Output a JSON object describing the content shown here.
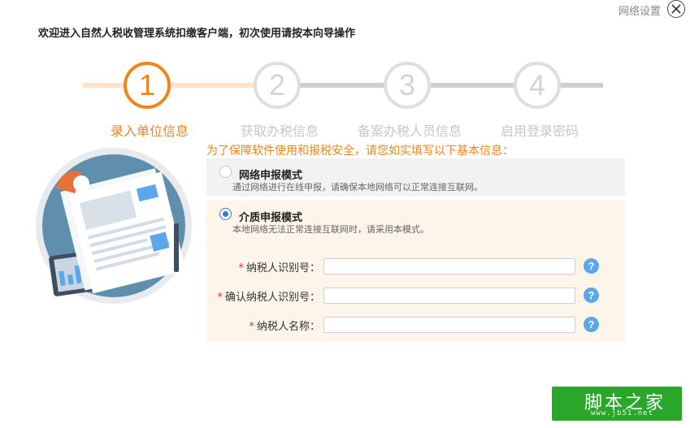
{
  "header": {
    "network_settings_label": "网络设置",
    "welcome_text": "欢迎进入自然人税收管理系统扣缴客户端，初次使用请按本向导操作"
  },
  "steps": [
    {
      "number": "1",
      "label": "录入单位信息",
      "active": true
    },
    {
      "number": "2",
      "label": "获取办税信息",
      "active": false
    },
    {
      "number": "3",
      "label": "备案办税人员信息",
      "active": false
    },
    {
      "number": "4",
      "label": "启用登录密码",
      "active": false
    }
  ],
  "notice": "为了保障软件使用和报税安全，请您如实填写以下基本信息：",
  "modes": {
    "network": {
      "title": "网络申报模式",
      "desc": "通过网络进行在线申报，请确保本地网络可以正常连接互联网。",
      "selected": false
    },
    "media": {
      "title": "介质申报模式",
      "desc": "本地网络无法正常连接互联网时，请采用本模式。",
      "selected": true
    }
  },
  "form": {
    "required_mark": "*",
    "taxpayer_id_label": "纳税人识别号：",
    "confirm_taxpayer_id_label": "确认纳税人识别号：",
    "taxpayer_name_label": "纳税人名称：",
    "taxpayer_id_value": "",
    "confirm_taxpayer_id_value": "",
    "taxpayer_name_value": "",
    "help_symbol": "?"
  },
  "watermark": {
    "main": "脚本之家",
    "sub": "www.jb51.net"
  },
  "colors": {
    "accent": "#f08519",
    "inactive_step": "#dedede",
    "help": "#5ba7ea",
    "selected_radio": "#3a7bd5",
    "media_panel_bg": "#fdf4ea",
    "network_panel_bg": "#f2f2f2",
    "watermark_bg": "#2aa62a"
  }
}
